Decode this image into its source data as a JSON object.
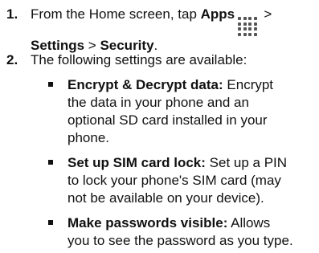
{
  "steps": [
    {
      "number": "1.",
      "line1_pre": "From the Home screen, tap ",
      "apps_label": "Apps",
      "apps_icon": "apps-grid-icon",
      "line1_post": " >",
      "settings_label": "Settings",
      "separator": " > ",
      "security_label": "Security",
      "period": "."
    },
    {
      "number": "2.",
      "text": "The following settings are available:"
    }
  ],
  "settings": [
    {
      "title": "Encrypt & Decrypt data:",
      "lines": [
        " Encrypt",
        "the data in your phone and an",
        "optional SD card installed in your",
        "phone."
      ]
    },
    {
      "title": "Set up SIM card lock:",
      "lines": [
        " Set up a PIN",
        "to lock your phone's SIM card (may",
        "not be available on your device)."
      ]
    },
    {
      "title": "Make passwords visible:",
      "lines": [
        " Allows",
        "you to see the password as you type."
      ]
    }
  ]
}
